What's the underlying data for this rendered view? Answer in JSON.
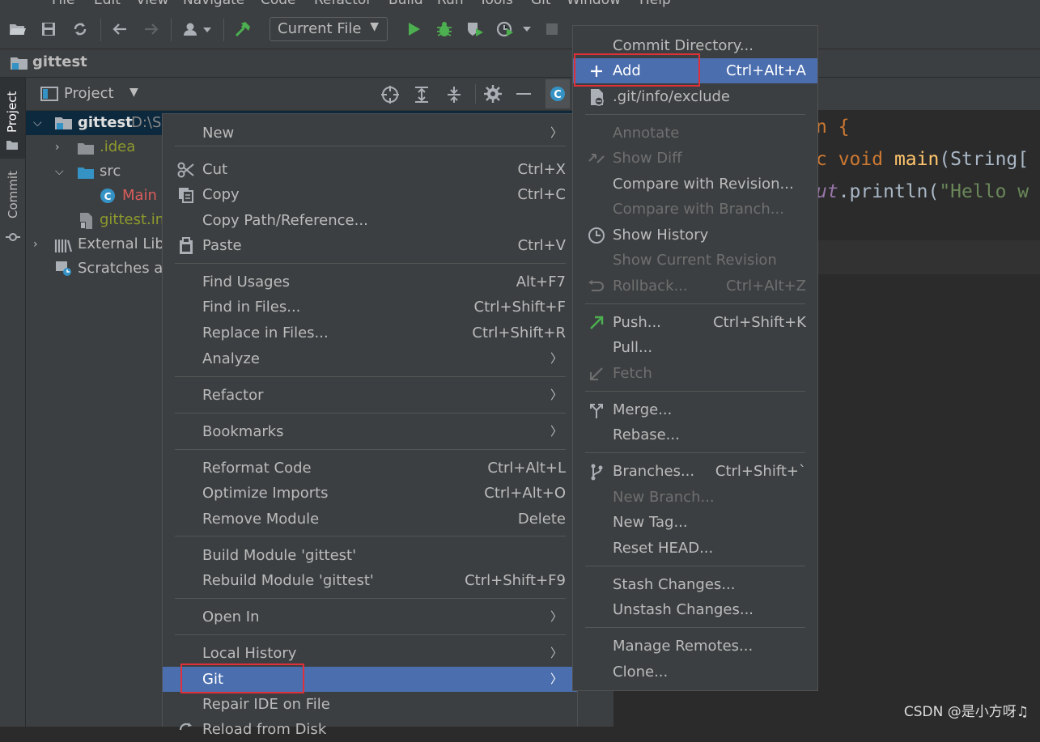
{
  "menubar": {
    "items": [
      "File",
      "Edit",
      "View",
      "Navigate",
      "Code",
      "Refactor",
      "Build",
      "Run",
      "Tools",
      "Git",
      "Window",
      "Help"
    ]
  },
  "toolbar": {
    "run_config": "Current File"
  },
  "navbar": {
    "project_name": "gittest"
  },
  "side_tabs": {
    "project": "Project",
    "commit": "Commit"
  },
  "project_panel": {
    "title": "Project",
    "tree": {
      "root_name": "gittest",
      "root_path": "D:\\Se",
      "idea": ".idea",
      "src": "src",
      "main": "Main",
      "iml": "gittest.im",
      "ext_libs": "External Libr",
      "scratches": "Scratches an"
    }
  },
  "editor": {
    "line1": "n {",
    "line2_a": "c void ",
    "line2_b": "main",
    "line2_c": "(String[",
    "line3_a": "ut",
    "line3_b": ".println(",
    "line3_c": "\"Hello w"
  },
  "context_menu": {
    "items": [
      {
        "label": "New",
        "shortcut": "",
        "submenu": true
      },
      {
        "label": "Cut",
        "shortcut": "Ctrl+X"
      },
      {
        "label": "Copy",
        "shortcut": "Ctrl+C"
      },
      {
        "label": "Copy Path/Reference...",
        "shortcut": ""
      },
      {
        "label": "Paste",
        "shortcut": "Ctrl+V"
      },
      {
        "label": "Find Usages",
        "shortcut": "Alt+F7"
      },
      {
        "label": "Find in Files...",
        "shortcut": "Ctrl+Shift+F"
      },
      {
        "label": "Replace in Files...",
        "shortcut": "Ctrl+Shift+R"
      },
      {
        "label": "Analyze",
        "shortcut": "",
        "submenu": true
      },
      {
        "label": "Refactor",
        "shortcut": "",
        "submenu": true
      },
      {
        "label": "Bookmarks",
        "shortcut": "",
        "submenu": true
      },
      {
        "label": "Reformat Code",
        "shortcut": "Ctrl+Alt+L"
      },
      {
        "label": "Optimize Imports",
        "shortcut": "Ctrl+Alt+O"
      },
      {
        "label": "Remove Module",
        "shortcut": "Delete"
      },
      {
        "label": "Build Module 'gittest'",
        "shortcut": ""
      },
      {
        "label": "Rebuild Module 'gittest'",
        "shortcut": "Ctrl+Shift+F9"
      },
      {
        "label": "Open In",
        "shortcut": "",
        "submenu": true
      },
      {
        "label": "Local History",
        "shortcut": "",
        "submenu": true
      },
      {
        "label": "Git",
        "shortcut": "",
        "submenu": true,
        "selected": true
      },
      {
        "label": "Repair IDE on File",
        "shortcut": ""
      },
      {
        "label": "Reload from Disk",
        "shortcut": ""
      }
    ]
  },
  "git_menu": {
    "items": [
      {
        "label": "Commit Directory...",
        "shortcut": ""
      },
      {
        "label": "Add",
        "shortcut": "Ctrl+Alt+A",
        "selected": true
      },
      {
        "label": ".git/info/exclude",
        "shortcut": ""
      },
      {
        "label": "Annotate",
        "shortcut": "",
        "disabled": true
      },
      {
        "label": "Show Diff",
        "shortcut": "",
        "disabled": true
      },
      {
        "label": "Compare with Revision...",
        "shortcut": ""
      },
      {
        "label": "Compare with Branch...",
        "shortcut": "",
        "disabled": true
      },
      {
        "label": "Show History",
        "shortcut": ""
      },
      {
        "label": "Show Current Revision",
        "shortcut": "",
        "disabled": true
      },
      {
        "label": "Rollback...",
        "shortcut": "Ctrl+Alt+Z",
        "disabled": true
      },
      {
        "label": "Push...",
        "shortcut": "Ctrl+Shift+K"
      },
      {
        "label": "Pull...",
        "shortcut": ""
      },
      {
        "label": "Fetch",
        "shortcut": "",
        "disabled": true
      },
      {
        "label": "Merge...",
        "shortcut": ""
      },
      {
        "label": "Rebase...",
        "shortcut": ""
      },
      {
        "label": "Branches...",
        "shortcut": "Ctrl+Shift+`"
      },
      {
        "label": "New Branch...",
        "shortcut": "",
        "disabled": true
      },
      {
        "label": "New Tag...",
        "shortcut": ""
      },
      {
        "label": "Reset HEAD...",
        "shortcut": ""
      },
      {
        "label": "Stash Changes...",
        "shortcut": ""
      },
      {
        "label": "Unstash Changes...",
        "shortcut": ""
      },
      {
        "label": "Manage Remotes...",
        "shortcut": ""
      },
      {
        "label": "Clone...",
        "shortcut": ""
      }
    ]
  },
  "watermark": "CSDN @是小方呀♫",
  "colors": {
    "selection": "#4b6eaf",
    "highlight_box": "#e0303a",
    "menu_bg": "#3c3f41"
  }
}
